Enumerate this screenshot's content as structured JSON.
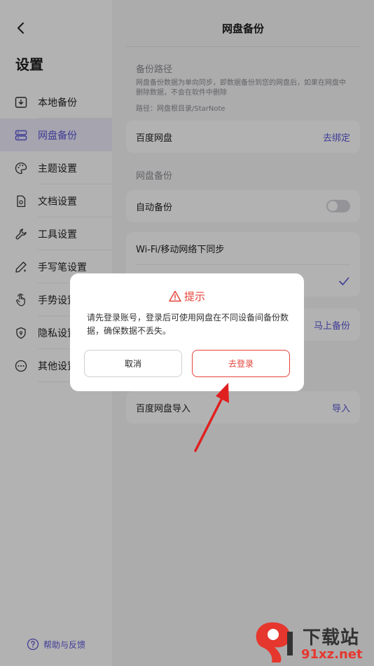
{
  "sidebar": {
    "title": "设置",
    "items": [
      {
        "label": "本地备份",
        "icon": "local-backup-icon"
      },
      {
        "label": "网盘备份",
        "icon": "cloud-backup-icon",
        "active": true
      },
      {
        "label": "主题设置",
        "icon": "palette-icon"
      },
      {
        "label": "文档设置",
        "icon": "document-icon"
      },
      {
        "label": "工具设置",
        "icon": "wrench-icon"
      },
      {
        "label": "手写笔设置",
        "icon": "pen-icon"
      },
      {
        "label": "手势设置",
        "icon": "gesture-hand-icon"
      },
      {
        "label": "隐私设置",
        "icon": "shield-icon"
      },
      {
        "label": "其他设置",
        "icon": "more-icon"
      }
    ],
    "help_label": "帮助与反馈"
  },
  "main": {
    "title": "网盘备份",
    "backup_path": {
      "label": "备份路径",
      "description": "网盘备份数据为单向同步，即数据备份到您的网盘后，如果在网盘中删除数据，不会在软件中删除",
      "path": "路径：网盘根目录/StarNote"
    },
    "baidu_card": {
      "label": "百度网盘",
      "action": "去绑定"
    },
    "cloud_section_label": "网盘备份",
    "auto_backup": {
      "label": "自动备份",
      "enabled": false
    },
    "wifi_sync": {
      "label": "Wi-Fi/移动网络下同步"
    },
    "backup_now_action": "马上备份",
    "import_card": {
      "label": "百度网盘导入",
      "action": "导入"
    }
  },
  "dialog": {
    "title": "提示",
    "message": "请先登录账号，登录后可使用网盘在不同设备间备份数据，确保数据不丢失。",
    "cancel_label": "取消",
    "login_label": "去登录"
  },
  "watermark": {
    "text1": "下载站",
    "text2": "91xz.net"
  },
  "colors": {
    "accent": "#5b56d6",
    "alert": "#e5443a",
    "arrow": "#e02020"
  }
}
